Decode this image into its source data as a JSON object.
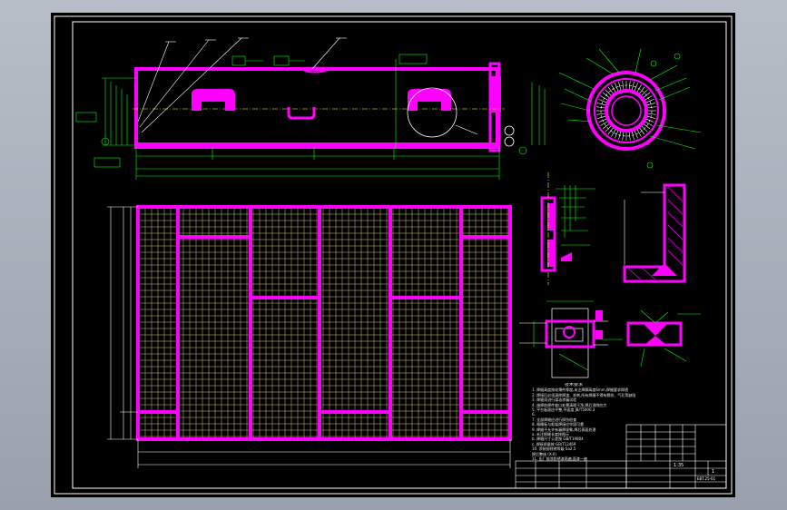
{
  "drawing": {
    "colors": {
      "background": "#000000",
      "frame": "#ffffff",
      "part": "#ff00ff",
      "dimension": "#00ff00",
      "grid": "#f0e68c",
      "centerline": "#ffff00",
      "text": "#ffffff"
    },
    "notes": {
      "title": "技术要求",
      "lines": [
        "1. 焊缝高度按较薄件厚度,未注焊脚高度6mm,焊缝要求焊透",
        "2. 焊接后必须清除焊渣、毛刺,所有焊缝不得有裂纹、气孔等缺陷",
        "3. 焊缝须进行煤油渗漏试验",
        "4. 施焊前焊件坡口处需清理干净,焊后消除应力",
        "5. 平台板面应平整,平面度 JB/T5000.3",
        "6.",
        "7. 全部焊缝应进行探伤检查",
        "8. 格栅板与框架焊接应牢固可靠",
        "9. 焊缝不允许有漏焊现象,焊后表面处理",
        "   a. 未注焊缝长度按图示",
        "   b. 焊缝尺寸公差按 GB/T19804",
        "   c. 焊接质量按 GB/T12469",
        "10. 涂装前除锈等级 Sa2.5",
        "    焊后整体 (X-X)",
        "11. 出厂前涂防锈漆两遍,面漆一遍"
      ]
    },
    "title_block": {
      "scale": "1:35",
      "sheet": "1",
      "code": "EBT.25-01"
    }
  }
}
